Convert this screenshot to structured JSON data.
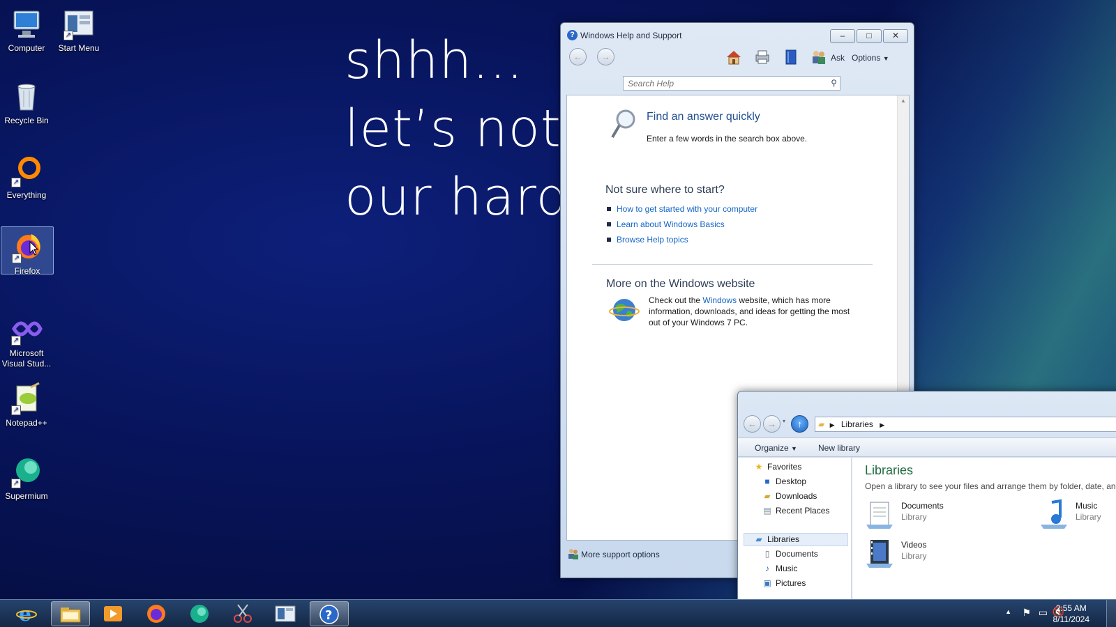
{
  "desktop": {
    "wallpaper_lines": [
      "shhh...",
      "let’s not l",
      "our hard"
    ],
    "icons": [
      {
        "label": "Computer",
        "icon": "computer-icon"
      },
      {
        "label": "Start Menu",
        "icon": "start-menu-icon"
      },
      {
        "label": "Recycle Bin",
        "icon": "recycle-bin-icon"
      },
      {
        "label": "Everything",
        "icon": "everything-icon"
      },
      {
        "label": "Firefox",
        "icon": "firefox-icon"
      },
      {
        "label": "Microsoft Visual Stud...",
        "icon": "visual-studio-icon"
      },
      {
        "label": "Notepad++",
        "icon": "notepadpp-icon"
      },
      {
        "label": "Supermium",
        "icon": "supermium-icon"
      }
    ]
  },
  "help": {
    "title": "Windows Help and Support",
    "toolbar": {
      "ask": "Ask",
      "options": "Options"
    },
    "search_placeholder": "Search Help",
    "find_title": "Find an answer quickly",
    "find_text": "Enter a few words in the search box above.",
    "not_sure": "Not sure where to start?",
    "links": [
      "How to get started with your computer",
      "Learn about Windows Basics",
      "Browse Help topics"
    ],
    "more_title": "More on the Windows website",
    "more_text_pre": "Check out the ",
    "more_link": "Windows",
    "more_text_post": " website, which has more information, downloads, and ideas for getting the most out of your Windows 7 PC.",
    "footer": "More support options"
  },
  "explorer": {
    "address": "Libraries",
    "cmd": {
      "organize": "Organize",
      "new_library": "New library"
    },
    "nav": {
      "favorites": "Favorites",
      "favorites_items": [
        "Desktop",
        "Downloads",
        "Recent Places"
      ],
      "libraries": "Libraries",
      "libraries_items": [
        "Documents",
        "Music",
        "Pictures"
      ]
    },
    "content": {
      "title": "Libraries",
      "subtitle": "Open a library to see your files and arrange them by folder, date, and",
      "items": [
        {
          "name": "Documents",
          "type": "Library"
        },
        {
          "name": "Music",
          "type": "Library"
        },
        {
          "name": "Videos",
          "type": "Library"
        }
      ]
    }
  },
  "taskbar": {
    "time": "2:55 AM",
    "date": "8/11/2024"
  }
}
